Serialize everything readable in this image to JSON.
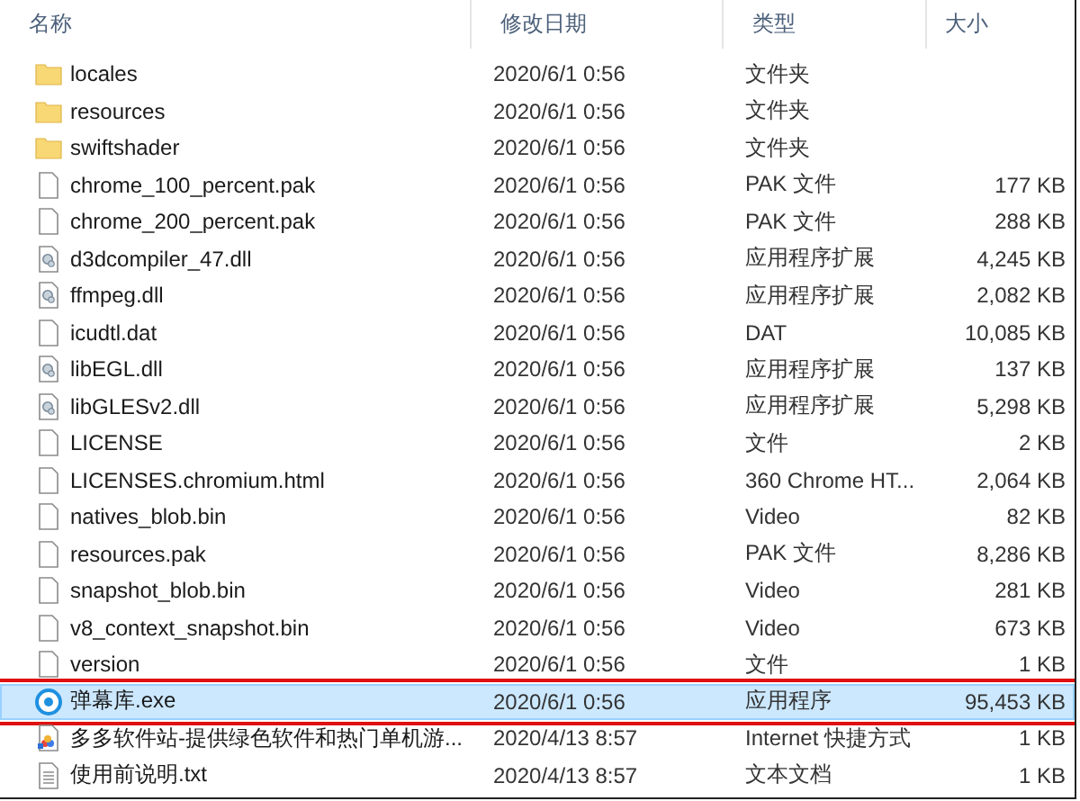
{
  "columns": [
    "名称",
    "修改日期",
    "类型",
    "大小"
  ],
  "rows": [
    {
      "kind": "folder",
      "name": "locales",
      "date": "2020/6/1 0:56",
      "type": "文件夹",
      "size": "",
      "selected": false,
      "outlined": false
    },
    {
      "kind": "folder",
      "name": "resources",
      "date": "2020/6/1 0:56",
      "type": "文件夹",
      "size": "",
      "selected": false,
      "outlined": false
    },
    {
      "kind": "folder",
      "name": "swiftshader",
      "date": "2020/6/1 0:56",
      "type": "文件夹",
      "size": "",
      "selected": false,
      "outlined": false
    },
    {
      "kind": "file",
      "name": "chrome_100_percent.pak",
      "date": "2020/6/1 0:56",
      "type": "PAK 文件",
      "size": "177 KB",
      "selected": false,
      "outlined": false
    },
    {
      "kind": "file",
      "name": "chrome_200_percent.pak",
      "date": "2020/6/1 0:56",
      "type": "PAK 文件",
      "size": "288 KB",
      "selected": false,
      "outlined": false
    },
    {
      "kind": "dll",
      "name": "d3dcompiler_47.dll",
      "date": "2020/6/1 0:56",
      "type": "应用程序扩展",
      "size": "4,245 KB",
      "selected": false,
      "outlined": false
    },
    {
      "kind": "dll",
      "name": "ffmpeg.dll",
      "date": "2020/6/1 0:56",
      "type": "应用程序扩展",
      "size": "2,082 KB",
      "selected": false,
      "outlined": false
    },
    {
      "kind": "file",
      "name": "icudtl.dat",
      "date": "2020/6/1 0:56",
      "type": "DAT",
      "size": "10,085 KB",
      "selected": false,
      "outlined": false
    },
    {
      "kind": "dll",
      "name": "libEGL.dll",
      "date": "2020/6/1 0:56",
      "type": "应用程序扩展",
      "size": "137 KB",
      "selected": false,
      "outlined": false
    },
    {
      "kind": "dll",
      "name": "libGLESv2.dll",
      "date": "2020/6/1 0:56",
      "type": "应用程序扩展",
      "size": "5,298 KB",
      "selected": false,
      "outlined": false
    },
    {
      "kind": "file",
      "name": "LICENSE",
      "date": "2020/6/1 0:56",
      "type": "文件",
      "size": "2 KB",
      "selected": false,
      "outlined": false
    },
    {
      "kind": "file",
      "name": "LICENSES.chromium.html",
      "date": "2020/6/1 0:56",
      "type": "360 Chrome HT...",
      "size": "2,064 KB",
      "selected": false,
      "outlined": false
    },
    {
      "kind": "file",
      "name": "natives_blob.bin",
      "date": "2020/6/1 0:56",
      "type": "Video",
      "size": "82 KB",
      "selected": false,
      "outlined": false
    },
    {
      "kind": "file",
      "name": "resources.pak",
      "date": "2020/6/1 0:56",
      "type": "PAK 文件",
      "size": "8,286 KB",
      "selected": false,
      "outlined": false
    },
    {
      "kind": "file",
      "name": "snapshot_blob.bin",
      "date": "2020/6/1 0:56",
      "type": "Video",
      "size": "281 KB",
      "selected": false,
      "outlined": false
    },
    {
      "kind": "file",
      "name": "v8_context_snapshot.bin",
      "date": "2020/6/1 0:56",
      "type": "Video",
      "size": "673 KB",
      "selected": false,
      "outlined": false
    },
    {
      "kind": "file",
      "name": "version",
      "date": "2020/6/1 0:56",
      "type": "文件",
      "size": "1 KB",
      "selected": false,
      "outlined": false
    },
    {
      "kind": "exe",
      "name": "弹幕库.exe",
      "date": "2020/6/1 0:56",
      "type": "应用程序",
      "size": "95,453 KB",
      "selected": true,
      "outlined": true
    },
    {
      "kind": "shortcut",
      "name": "多多软件站-提供绿色软件和热门单机游...",
      "date": "2020/4/13 8:57",
      "type": "Internet 快捷方式",
      "size": "1 KB",
      "selected": false,
      "outlined": false
    },
    {
      "kind": "txt",
      "name": "使用前说明.txt",
      "date": "2020/4/13 8:57",
      "type": "文本文档",
      "size": "1 KB",
      "selected": false,
      "outlined": false
    }
  ]
}
